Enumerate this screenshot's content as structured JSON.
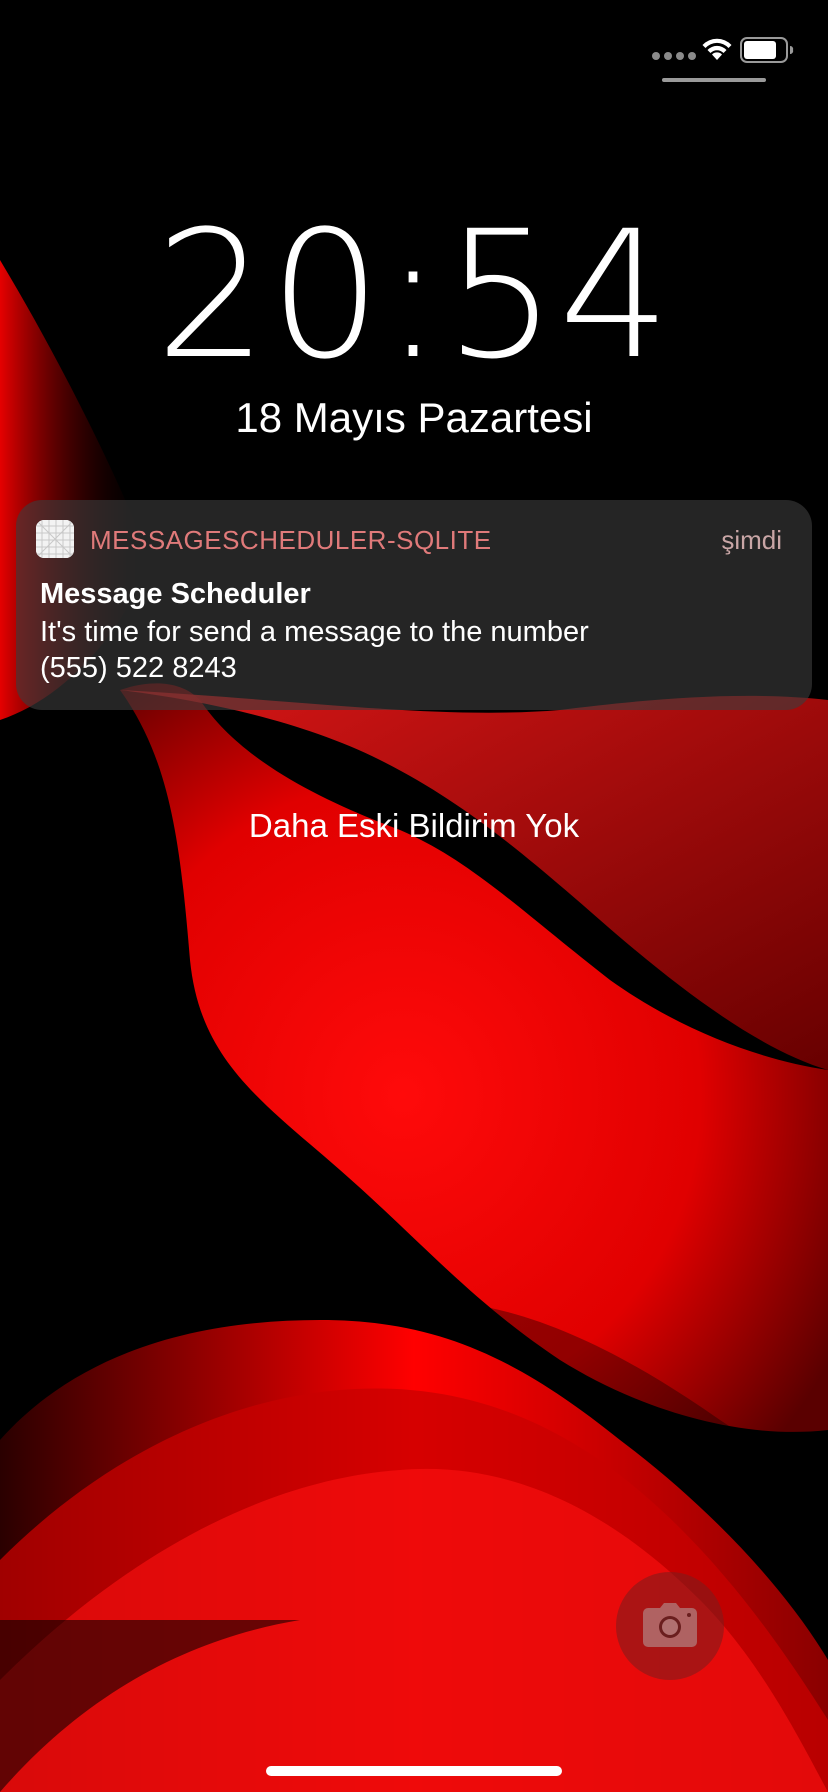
{
  "status_bar": {
    "wifi_icon": "wifi-icon",
    "battery_icon": "battery-icon",
    "signal_icon": "cellular-signal-icon"
  },
  "lock_screen": {
    "time": "20:54",
    "date": "18 Mayıs Pazartesi"
  },
  "notification": {
    "app_icon": "app-icon",
    "app_name": "MESSAGESCHEDULER-SQLITE",
    "time": "şimdi",
    "title": "Message Scheduler",
    "body": "It's time for send a message to the number\n (555) 522 8243"
  },
  "no_older_notifications": "Daha Eski Bildirim Yok",
  "camera_icon": "camera-icon",
  "colors": {
    "accent_red": "#ff0000",
    "app_name_color": "#e07a7a",
    "background": "#000000"
  }
}
